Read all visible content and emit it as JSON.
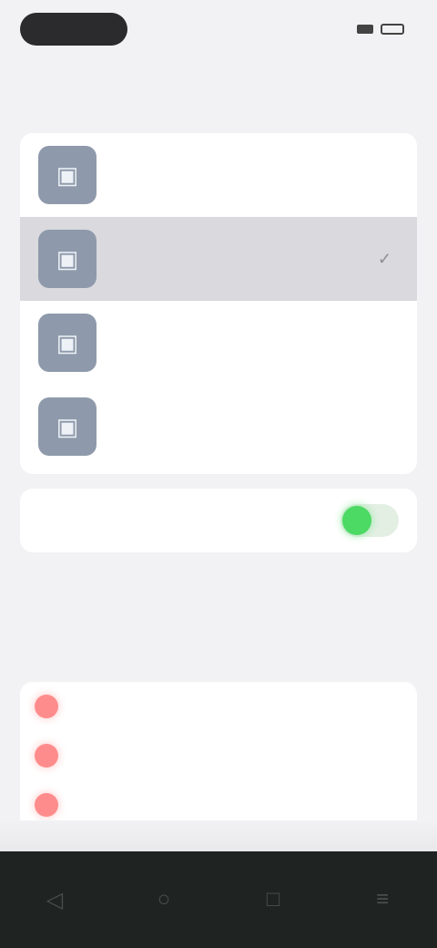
{
  "status_bar": {
    "time": "",
    "icons": [
      "signal-icon",
      "battery-icon"
    ]
  },
  "nav": {
    "title": ""
  },
  "options": [
    {
      "label": "",
      "icon": "image-icon",
      "selected": false
    },
    {
      "label": "",
      "icon": "image-icon",
      "selected": true
    },
    {
      "label": "",
      "icon": "image-icon",
      "selected": false
    },
    {
      "label": "",
      "icon": "image-icon",
      "selected": false
    }
  ],
  "toggle": {
    "label": "",
    "on": true
  },
  "section": {
    "title": "",
    "description": ""
  },
  "list": [
    {
      "label": "",
      "icon": "red-dot-icon"
    },
    {
      "label": "",
      "icon": "red-dot-icon"
    },
    {
      "label": "",
      "icon": "red-dot-icon"
    }
  ],
  "tabs": [
    "",
    "",
    ""
  ],
  "colors": {
    "accent_green": "#4cd964",
    "dot_red": "#ff8c8c",
    "thumb": "#8e9aab",
    "bottom_bar": "#1f2322"
  }
}
